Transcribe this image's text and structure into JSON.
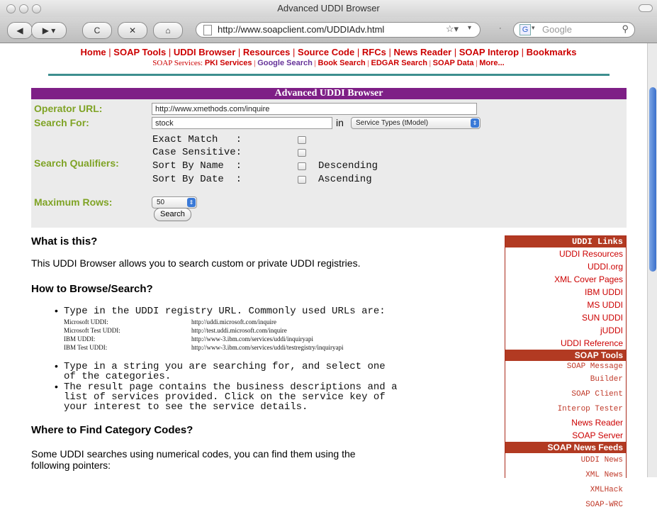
{
  "window": {
    "title": "Advanced UDDI Browser"
  },
  "toolbar": {
    "url": "http://www.soapclient.com/UDDIAdv.html",
    "search_placeholder": "Google",
    "google_glyph": "G",
    "back_icon": "◀",
    "forward_icon": "▶",
    "reload_icon": "C",
    "stop_icon": "✕",
    "home_icon": "⌂",
    "star_icon": "☆▾",
    "search_icon": "🔍"
  },
  "nav": {
    "main": [
      "Home",
      "SOAP Tools",
      "UDDI Browser",
      "Resources",
      "Source Code",
      "RFCs",
      "News Reader",
      "SOAP Interop",
      "Bookmarks"
    ],
    "services_label": "SOAP Services:",
    "services": [
      "PKI Services",
      "Google Search",
      "Book Search",
      "EDGAR Search",
      "SOAP Data",
      "More..."
    ]
  },
  "form": {
    "title": "Advanced UDDI Browser",
    "operator_label": "Operator URL:",
    "operator_value": "http://www.xmethods.com/inquire",
    "search_for_label": "Search For:",
    "search_for_value": "stock",
    "in_label": "in",
    "search_in_option": "Service Types (tModel)",
    "qualifiers_label": "Search Qualifiers:",
    "qualifiers": {
      "exact": "Exact Match   :",
      "case": "Case Sensitive:",
      "sort_name": "Sort By Name  :",
      "sort_date": "Sort By Date  :",
      "descending": "Descending",
      "ascending": "Ascending"
    },
    "max_rows_label": "Maximum Rows:",
    "max_rows_value": "50",
    "search_button": "Search"
  },
  "content": {
    "what_heading": "What is this?",
    "what_text": "This UDDI Browser allows you to search custom or private UDDI registries.",
    "how_heading": "How to Browse/Search?",
    "bullet1": "Type in the UDDI registry URL. Commonly used URLs are:",
    "registries": [
      {
        "name": "Microsoft UDDI:",
        "url": "http://uddi.microsoft.com/inquire"
      },
      {
        "name": "Microsoft Test UDDI:",
        "url": "http://test.uddi.microsoft.com/inquire"
      },
      {
        "name": "IBM UDDI:",
        "url": "http://www-3.ibm.com/services/uddi/inquiryapi"
      },
      {
        "name": "IBM Test UDDI:",
        "url": "http://www-3.ibm.com/services/uddi/testregistry/inquiryapi"
      }
    ],
    "bullet2_line1": "Type in a string you are searching for, and select one",
    "bullet2_line2": "of the categories.",
    "bullet3_line1": "The result page contains the business descriptions and a",
    "bullet3_line2": "list of services provided. Click on the service key of",
    "bullet3_line3": "your interest to see the service details.",
    "where_heading": "Where to Find Category Codes?",
    "where_text_line1": "Some UDDI searches using numerical codes, you can find them using the",
    "where_text_line2": "following pointers:"
  },
  "sidebar": {
    "uddi_head": "UDDI Links",
    "uddi_links": [
      "UDDI Resources",
      "UDDI.org",
      "XML Cover Pages",
      "IBM UDDI",
      "MS UDDI",
      "SUN UDDI",
      "jUDDI",
      "UDDI Reference"
    ],
    "soap_head": "SOAP Tools",
    "soap_links_mono": [
      "SOAP Message",
      "Builder",
      "SOAP Client",
      "Interop Tester"
    ],
    "soap_links": [
      "News Reader",
      "SOAP Server"
    ],
    "news_head": "SOAP News Feeds",
    "news_links": [
      "UDDI News",
      "XML News",
      "XMLHack",
      "SOAP-WRC"
    ]
  }
}
